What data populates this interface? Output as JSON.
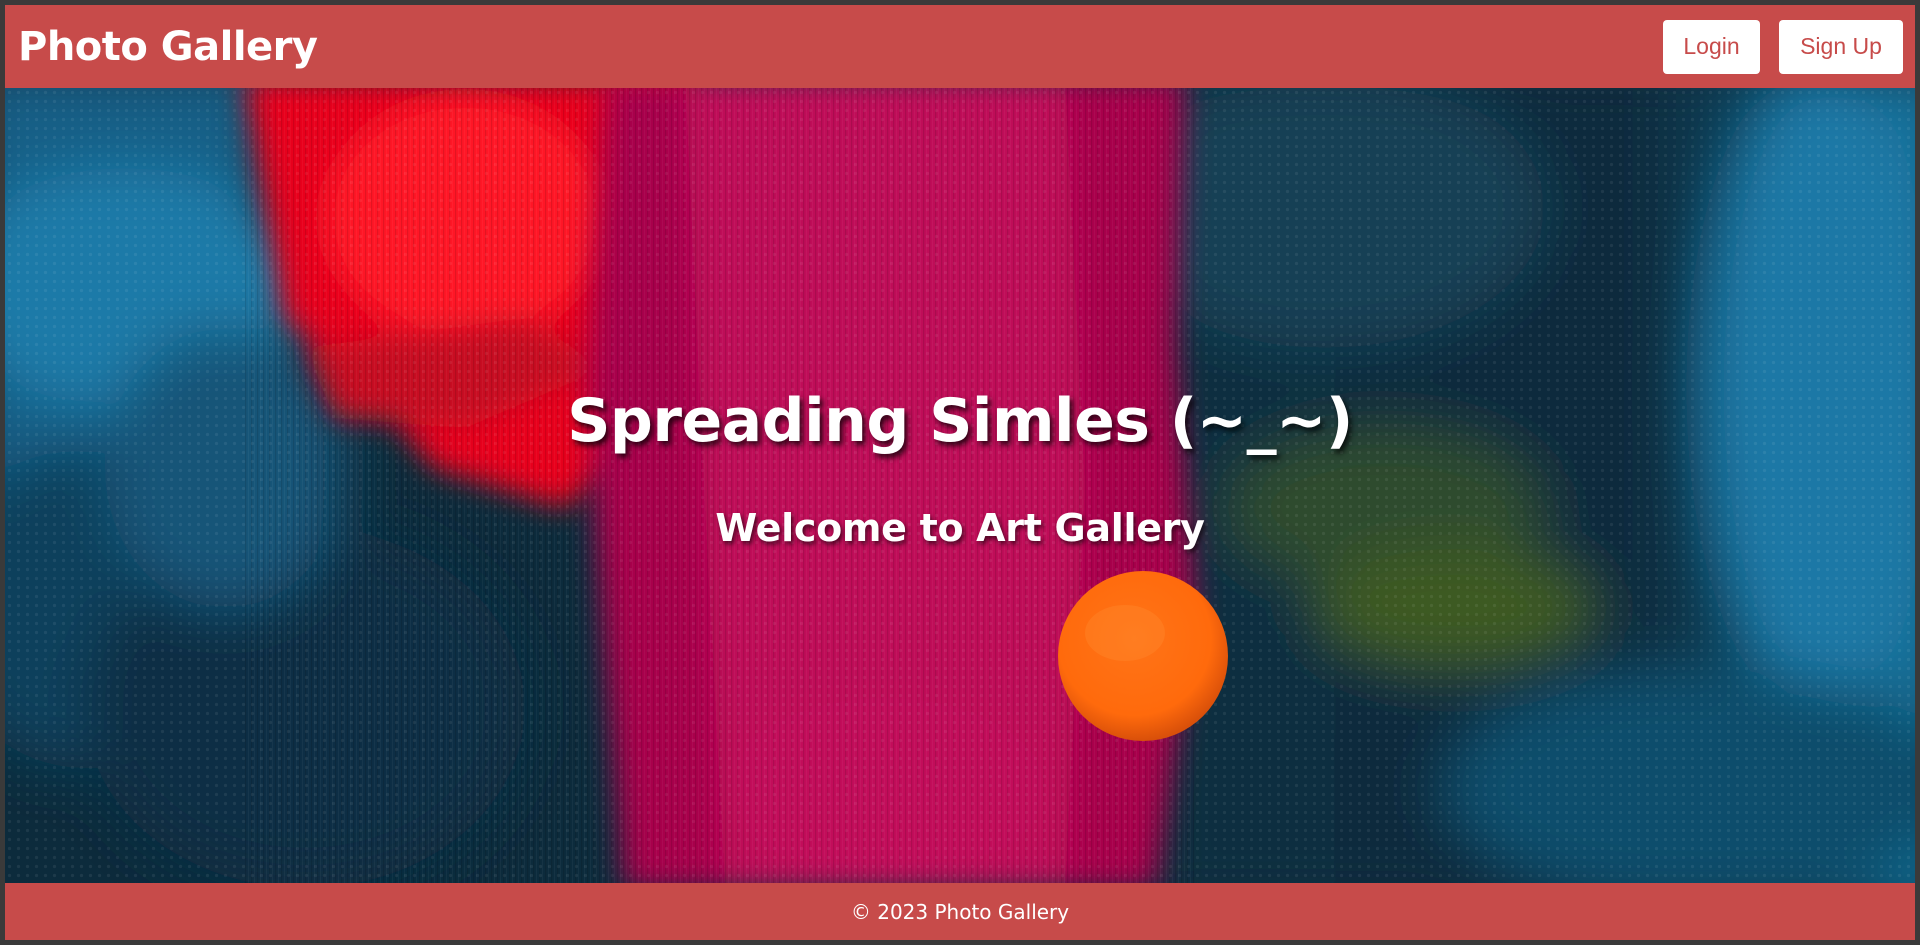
{
  "header": {
    "brand": "Photo Gallery",
    "login_label": "Login",
    "signup_label": "Sign Up"
  },
  "hero": {
    "title": "Spreading Simles (~_~)",
    "subtitle": "Welcome to Art Gallery",
    "background": "abstract-painting-image"
  },
  "footer": {
    "copyright": "© 2023 Photo Gallery"
  },
  "colors": {
    "brand": "#c74b4a",
    "button_bg": "#ffffff",
    "button_text": "#c74b4a",
    "text": "#ffffff"
  }
}
